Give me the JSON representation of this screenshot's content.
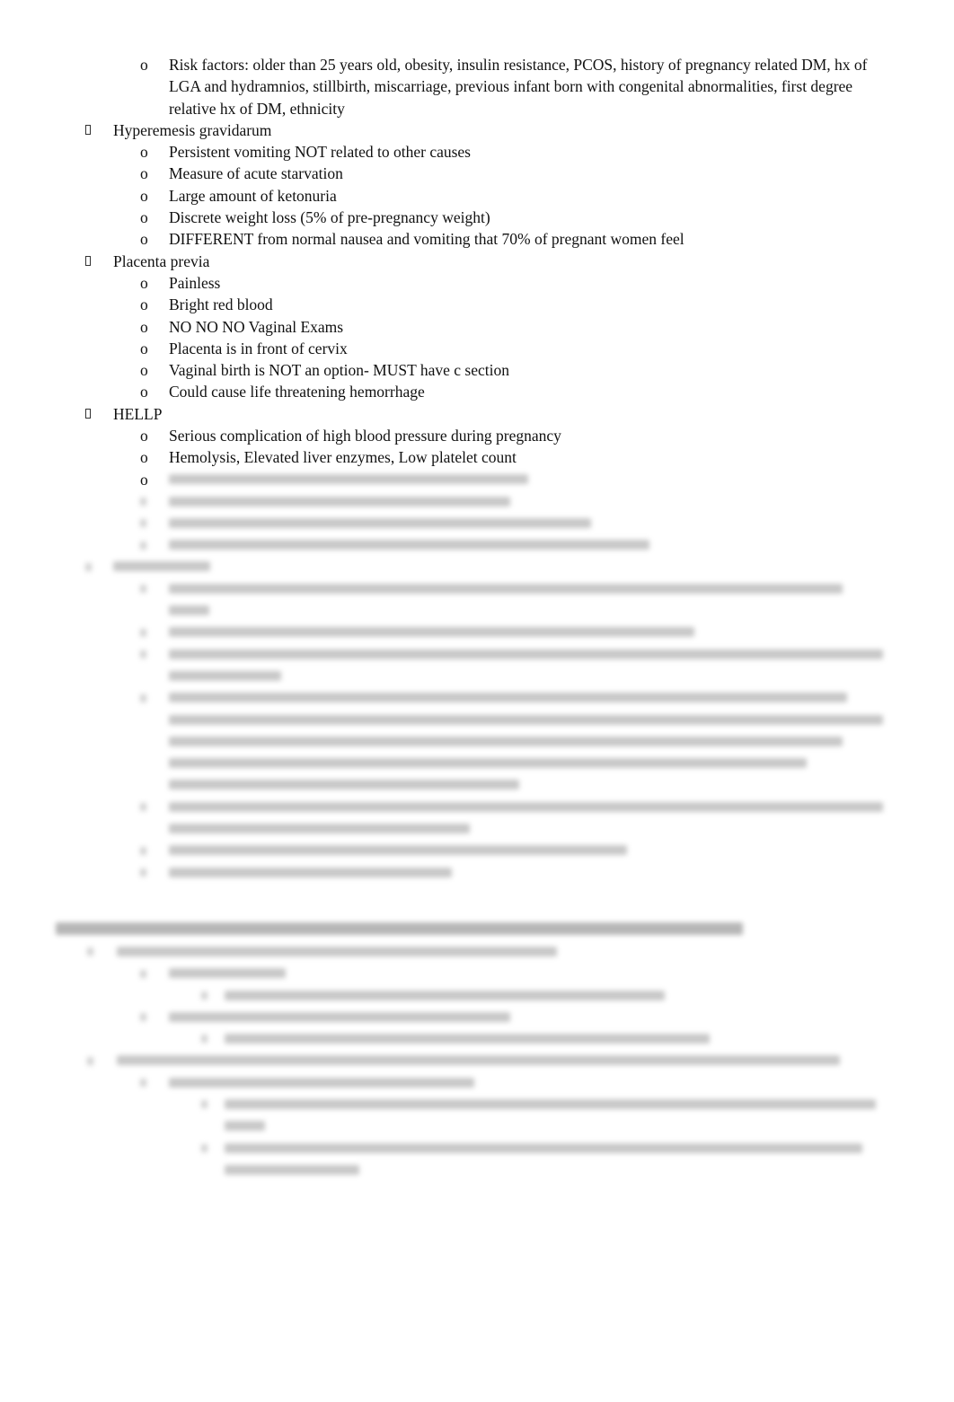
{
  "document": {
    "sections": [
      {
        "type": "sub",
        "text": "Risk factors: older than 25 years old, obesity, insulin resistance, PCOS, history of pregnancy related DM, hx of LGA and hydramnios, stillbirth, miscarriage, previous infant born with congenital abnormalities, first degree relative hx of DM, ethnicity"
      },
      {
        "type": "topic",
        "title": "Hyperemesis gravidarum",
        "items": [
          "Persistent vomiting NOT related to other causes",
          "Measure of acute starvation",
          "Large amount of ketonuria",
          "Discrete weight loss (5% of pre-pregnancy weight)",
          "DIFFERENT from normal nausea and vomiting that 70% of pregnant women feel"
        ]
      },
      {
        "type": "topic",
        "title": "Placenta previa",
        "items": [
          "Painless",
          "Bright red blood",
          "NO NO NO Vaginal Exams",
          "Placenta is in front of cervix",
          "Vaginal birth is NOT an option- MUST have c section",
          "Could cause life threatening hemorrhage"
        ]
      },
      {
        "type": "topic",
        "title": "HELLP",
        "items": [
          "Serious complication of high blood pressure during pregnancy",
          "Hemolysis, Elevated liver enzymes, Low platelet count"
        ]
      }
    ],
    "bullet_markers": {
      "level1": "missing-glyph-box",
      "level2": "o",
      "level3": "square"
    },
    "blurred_content_note": "Remaining content is blurred / obscured and not legible"
  }
}
